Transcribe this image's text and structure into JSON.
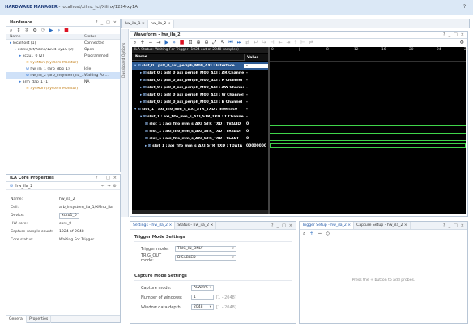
{
  "topbar": {
    "app": "HARDWARE MANAGER",
    "path": " - localhost/xilinx_tcf/Xilinx/1234-xy1A",
    "help": "?"
  },
  "hardware": {
    "title": "Hardware",
    "col_name": "Name",
    "col_status": "Status",
    "rows": [
      {
        "name": "localhost (1)",
        "status": "Connected"
      },
      {
        "name": "xilinx_tcf/Xilinx/1234-xy1A (2)",
        "status": "Open"
      },
      {
        "name": "xczu1_0 (2)",
        "status": "Programmed"
      },
      {
        "name": "SysMon (System Monitor)",
        "status": ""
      },
      {
        "name": "hw_ila_1 (arb_dbg_1)",
        "status": "Idle"
      },
      {
        "name": "hw_ila_2 (arb_insystem_ila_1)",
        "status": "Waiting For..."
      },
      {
        "name": "arm_dap_1 (1)",
        "status": "NA"
      },
      {
        "name": "SysMon (System Monitor)",
        "status": ""
      }
    ]
  },
  "ila_props": {
    "title": "ILA Core Properties",
    "selected": "hw_ila_2",
    "rows": [
      {
        "label": "Name:",
        "value": "hw_ila_2"
      },
      {
        "label": "Cell:",
        "value": "arb_insystem_ila_1/XMnu_ila"
      },
      {
        "label": "Device:",
        "value": "xczu1_0"
      },
      {
        "label": "HW core:",
        "value": "core_0"
      },
      {
        "label": "Capture sample count:",
        "value": "1024 of 2048"
      },
      {
        "label": "Core status:",
        "value": "Waiting For Trigger"
      }
    ],
    "tabs": [
      "General",
      "Properties"
    ]
  },
  "main_tabs": [
    "hw_ila_1",
    "hw_ila_2"
  ],
  "waveform": {
    "title": "Waveform - hw_ila_2",
    "side_label": "Dashboard Options",
    "status": "ILA Status: Waiting For Trigger (1024 out of 2048 samples)",
    "col_name": "Name",
    "col_value": "Value",
    "rows": [
      {
        "name": "slot_0 : ps8_0_axi_periph_M00_AXI : Interface",
        "value": "-"
      },
      {
        "name": "slot_0 : ps8_0_axi_periph_M00_AXI : AR Channel",
        "value": "-"
      },
      {
        "name": "slot_0 : ps8_0_axi_periph_M00_AXI : R Channel",
        "value": "-"
      },
      {
        "name": "slot_0 : ps8_0_axi_periph_M00_AXI : AW Channel",
        "value": "-"
      },
      {
        "name": "slot_0 : ps8_0_axi_periph_M00_AXI : W Channel",
        "value": "-"
      },
      {
        "name": "slot_0 : ps8_0_axi_periph_M00_AXI : B Channel",
        "value": "-"
      },
      {
        "name": "slot_1 : axi_fifo_mm_s_AXI_STR_TXD : Interface",
        "value": "-"
      },
      {
        "name": "slot_1 : axi_fifo_mm_s_AXI_STR_TXD : T Channel",
        "value": "-"
      },
      {
        "name": "slot_1 : axi_fifo_mm_s_AXI_STR_TXD : TVALID",
        "value": "0"
      },
      {
        "name": "slot_1 : axi_fifo_mm_s_AXI_STR_TXD : TREADY",
        "value": "0"
      },
      {
        "name": "slot_1 : axi_fifo_mm_s_AXI_STR_TXD : TLAST",
        "value": "0"
      },
      {
        "name": "slot_1 : axi_fifo_mm_s_AXI_STR_TXD : TDATA",
        "value": "00000000"
      }
    ],
    "ticks": [
      "0",
      "|",
      "8",
      "12",
      "16",
      "20",
      "24",
      "28"
    ]
  },
  "settings": {
    "tabs": [
      "Settings - hw_ila_2",
      "Status - hw_ila_2"
    ],
    "trigger_header": "Trigger Mode Settings",
    "trigger_mode_label": "Trigger mode:",
    "trigger_mode_value": "TRIG_IN_ONLY",
    "trig_out_label": "TRIG_OUT mode:",
    "trig_out_value": "DISABLED",
    "capture_header": "Capture Mode Settings",
    "capture_mode_label": "Capture mode:",
    "capture_mode_value": "ALWAYS",
    "windows_label": "Number of windows:",
    "windows_value": "1",
    "windows_range": "[1 - 2048]",
    "depth_label": "Window data depth:",
    "depth_value": "2048",
    "depth_range": "[1 - 2048]"
  },
  "trigger": {
    "tabs": [
      "Trigger Setup - hw_ila_2",
      "Capture Setup - hw_ila_2"
    ],
    "hint": "Press the  +  button to add probes."
  },
  "colors": {
    "accent": "#1f57a8",
    "play": "#2a6cc0",
    "stop": "#d12",
    "wave_bg": "#000000",
    "wave_line": "#3fd44a"
  }
}
